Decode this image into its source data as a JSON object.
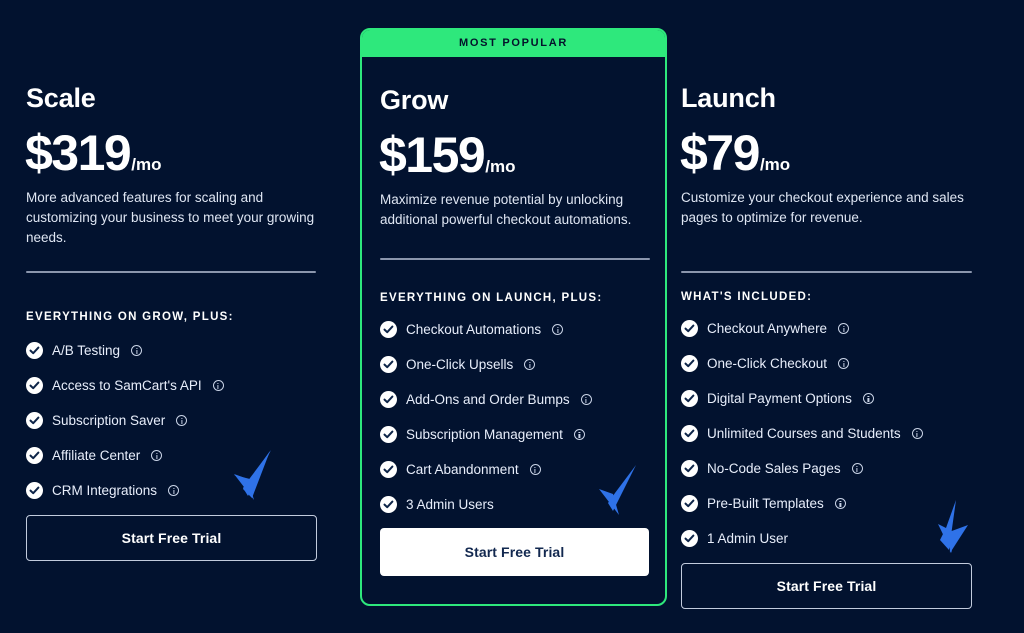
{
  "theme": {
    "background": "#02122f",
    "accent_green": "#2ee87c",
    "arrow_blue": "#2f72e8",
    "text_primary": "#ffffff",
    "text_secondary": "#dfe6f3",
    "divider": "#8b96ad"
  },
  "cta_label": "Start Free Trial",
  "plans": [
    {
      "id": "scale",
      "name": "Scale",
      "price": "$319",
      "period": "/mo",
      "blurb": "More advanced features for scaling and customizing your business to meet your growing needs.",
      "features_heading": "EVERYTHING ON GROW, PLUS:",
      "features": [
        {
          "label": "A/B Testing",
          "info": true
        },
        {
          "label": "Access to SamCart's API",
          "info": true
        },
        {
          "label": "Subscription Saver",
          "info": true
        },
        {
          "label": "Affiliate Center",
          "info": true
        },
        {
          "label": "CRM Integrations",
          "info": true
        }
      ],
      "cta_label": "Start Free Trial",
      "cta_style": "outline",
      "badge": null,
      "featured": false
    },
    {
      "id": "grow",
      "name": "Grow",
      "price": "$159",
      "period": "/mo",
      "blurb": "Maximize revenue potential by unlocking additional powerful checkout automations.",
      "features_heading": "EVERYTHING ON LAUNCH, PLUS:",
      "features": [
        {
          "label": "Checkout Automations",
          "info": true
        },
        {
          "label": "One-Click Upsells",
          "info": true
        },
        {
          "label": "Add-Ons and Order Bumps",
          "info": true
        },
        {
          "label": "Subscription Management",
          "info": true
        },
        {
          "label": "Cart Abandonment",
          "info": true
        },
        {
          "label": "3 Admin Users",
          "info": false
        }
      ],
      "cta_label": "Start Free Trial",
      "cta_style": "solid",
      "badge": "MOST POPULAR",
      "featured": true
    },
    {
      "id": "launch",
      "name": "Launch",
      "price": "$79",
      "period": "/mo",
      "blurb": "Customize your checkout experience and sales pages to optimize for revenue.",
      "features_heading": "WHAT'S INCLUDED:",
      "features": [
        {
          "label": "Checkout Anywhere",
          "info": true
        },
        {
          "label": "One-Click Checkout",
          "info": true
        },
        {
          "label": "Digital Payment Options",
          "info": true
        },
        {
          "label": "Unlimited Courses and Students",
          "info": true
        },
        {
          "label": "No-Code Sales Pages",
          "info": true
        },
        {
          "label": "Pre-Built Templates",
          "info": true
        },
        {
          "label": "1 Admin User",
          "info": false
        }
      ],
      "cta_label": "Start Free Trial",
      "cta_style": "outline",
      "badge": null,
      "featured": false
    }
  ],
  "annotations": [
    {
      "id": "arrow-scale",
      "points_to": "scale-start-free-trial-button"
    },
    {
      "id": "arrow-grow",
      "points_to": "grow-start-free-trial-button"
    },
    {
      "id": "arrow-launch",
      "points_to": "launch-start-free-trial-button"
    }
  ]
}
